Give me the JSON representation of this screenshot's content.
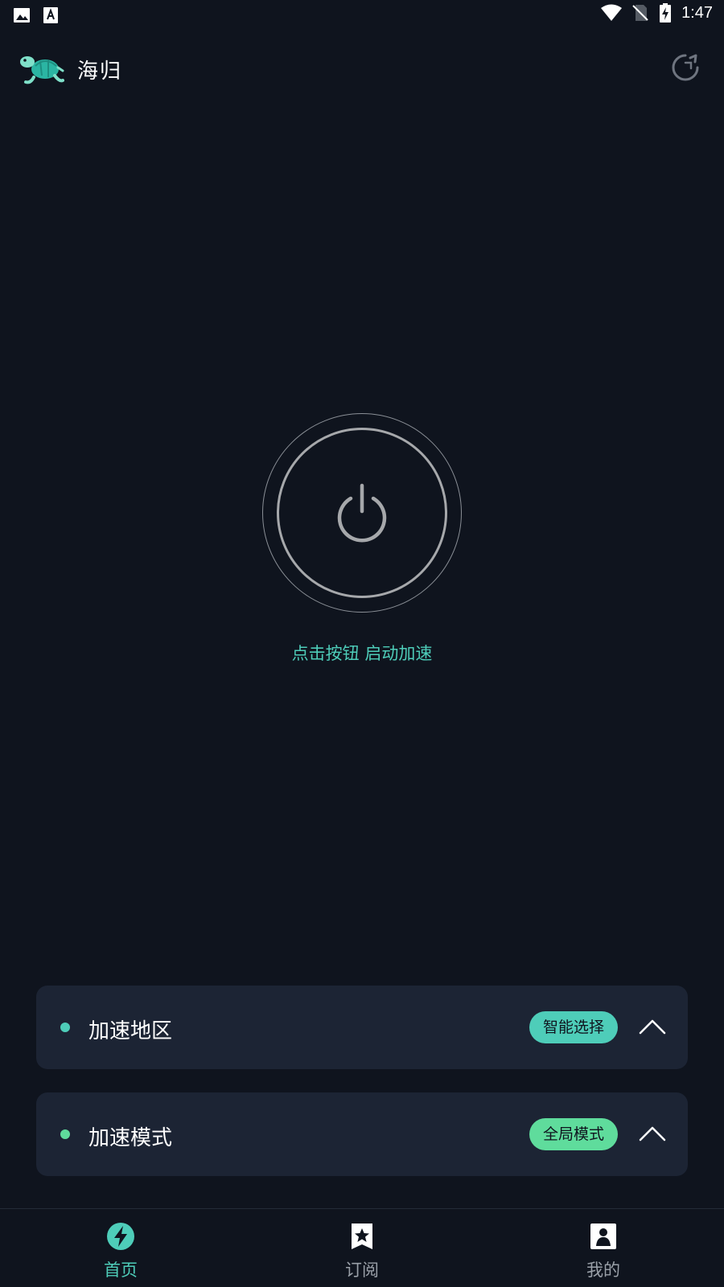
{
  "status_bar": {
    "time": "1:47",
    "left_icons": [
      "image-icon",
      "text-a-icon"
    ],
    "right_icons": [
      "wifi-icon",
      "no-sim-icon",
      "battery-charging-icon"
    ]
  },
  "header": {
    "app_name": "海归",
    "logo_icon": "turtle-logo-icon",
    "refresh_icon": "refresh-icon"
  },
  "main": {
    "power_icon": "power-icon",
    "hint": "点击按钮 启动加速"
  },
  "panels": [
    {
      "label": "加速地区",
      "badge": "智能选择",
      "dot_color": "#4ecdb9",
      "badge_color": "#4ecdb9"
    },
    {
      "label": "加速模式",
      "badge": "全局模式",
      "dot_color": "#5fdc9c",
      "badge_color": "#5fdc9c"
    }
  ],
  "nav": [
    {
      "label": "首页",
      "icon": "lightning-icon",
      "active": true
    },
    {
      "label": "订阅",
      "icon": "bookmark-star-icon",
      "active": false
    },
    {
      "label": "我的",
      "icon": "user-card-icon",
      "active": false
    }
  ],
  "colors": {
    "background": "#0f141e",
    "accent": "#4ecdb9",
    "panel": "#1c2434"
  }
}
